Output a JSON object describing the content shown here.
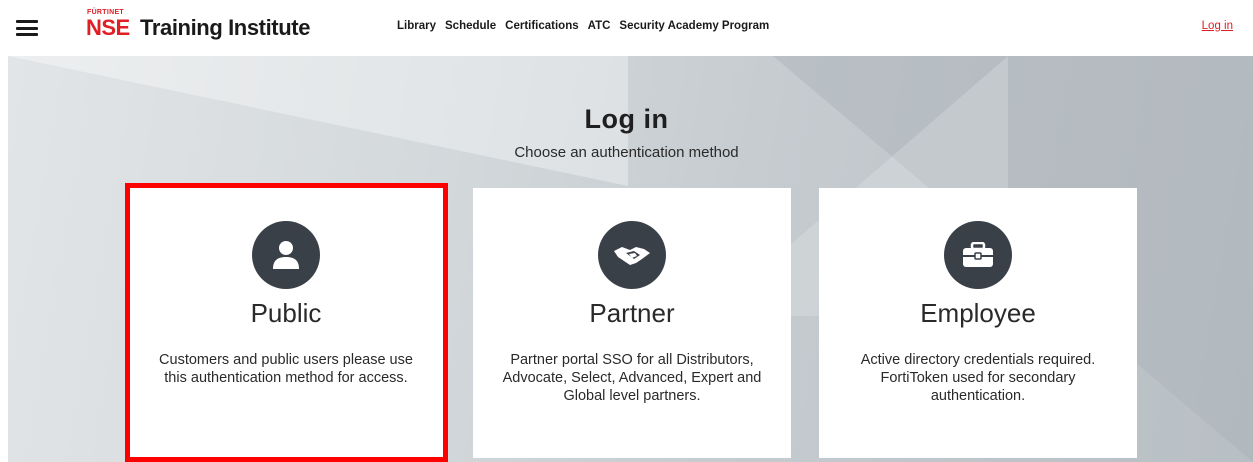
{
  "header": {
    "brand_small": "FÜRTINET",
    "brand_nse": "NSE",
    "brand_rest": "Training Institute",
    "nav": [
      "Library",
      "Schedule",
      "Certifications",
      "ATC",
      "Security Academy Program"
    ],
    "login_link": "Log in"
  },
  "main": {
    "title": "Log in",
    "subtitle": "Choose an authentication method"
  },
  "cards": [
    {
      "icon": "user-icon",
      "title": "Public",
      "description": "Customers and public users please use this authentication method for access."
    },
    {
      "icon": "handshake-icon",
      "title": "Partner",
      "description": "Partner portal SSO for all Distributors, Advocate, Select, Advanced, Expert and Global level partners."
    },
    {
      "icon": "briefcase-icon",
      "title": "Employee",
      "description": "Active directory credentials required. FortiToken used for secondary authentication."
    }
  ],
  "colors": {
    "brand_red": "#e01e26",
    "icon_circle": "#3a4048",
    "highlight": "#ff0000"
  }
}
